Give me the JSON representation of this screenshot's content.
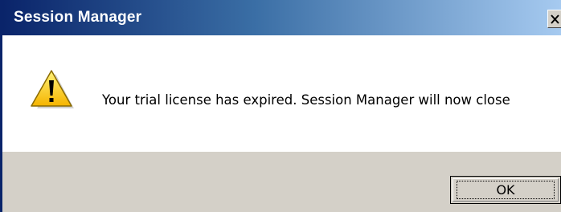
{
  "window": {
    "title": "Session Manager",
    "close_label": "X"
  },
  "dialog": {
    "icon": "warning-icon",
    "message": "Your trial license has expired. Session Manager will now close"
  },
  "buttons": {
    "ok_label": "OK"
  },
  "colors": {
    "titlebar_start": "#0a246a",
    "titlebar_end": "#a6caf0",
    "dialog_face": "#d4d0c8",
    "warning_yellow": "#ffcc00"
  }
}
